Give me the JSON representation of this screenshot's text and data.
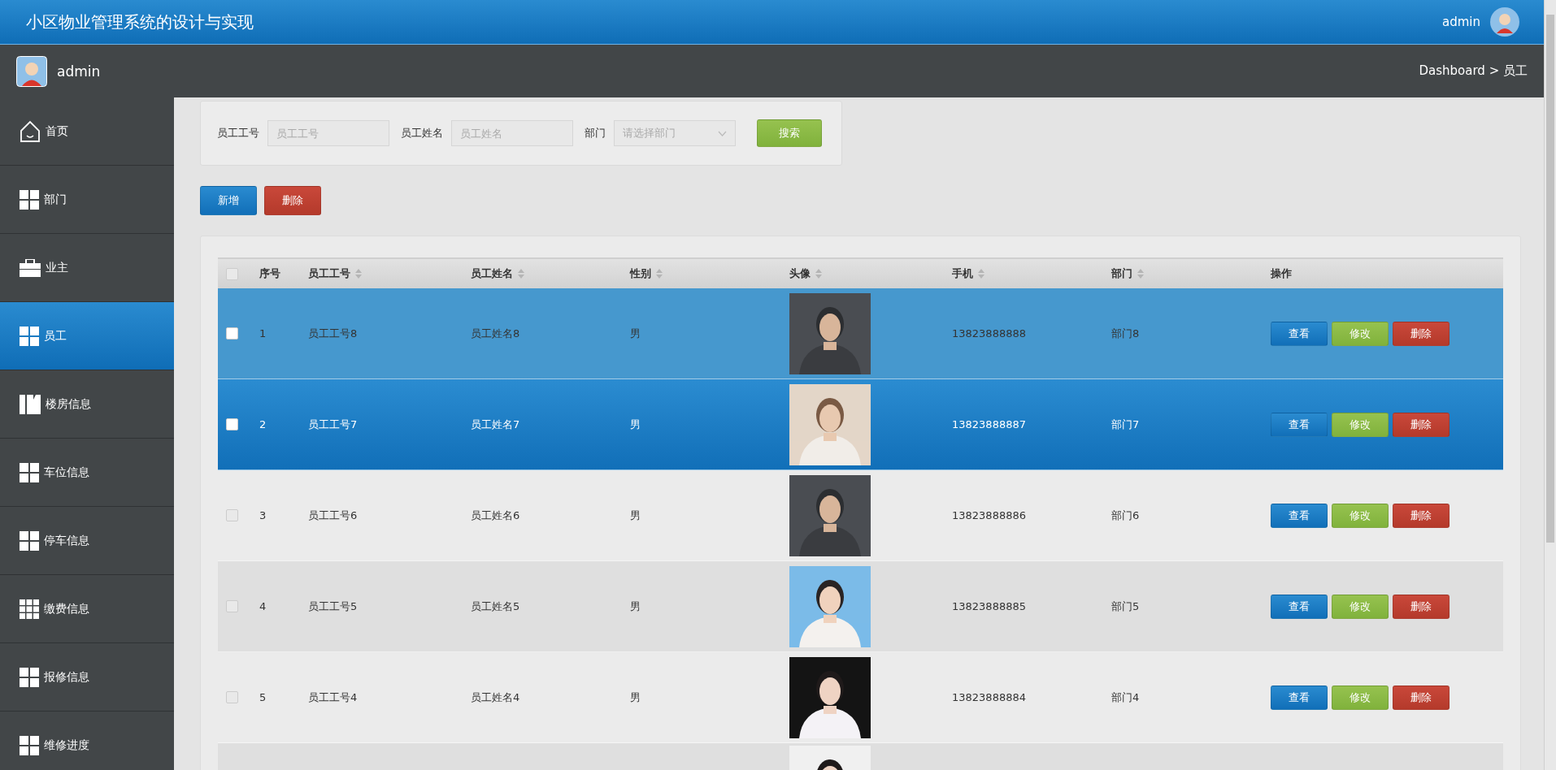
{
  "header": {
    "title": "小区物业管理系统的设计与实现",
    "user": "admin"
  },
  "subheader": {
    "user": "admin",
    "breadcrumb": "Dashboard > 员工"
  },
  "sidebar": {
    "items": [
      {
        "label": "首页",
        "kind": "home",
        "selected": false
      },
      {
        "label": "部门",
        "kind": "grid",
        "selected": false
      },
      {
        "label": "业主",
        "kind": "case",
        "selected": false
      },
      {
        "label": "员工",
        "kind": "grid",
        "selected": true
      },
      {
        "label": "楼房信息",
        "kind": "building",
        "selected": false
      },
      {
        "label": "车位信息",
        "kind": "grid",
        "selected": false
      },
      {
        "label": "停车信息",
        "kind": "grid",
        "selected": false
      },
      {
        "label": "缴费信息",
        "kind": "grid9",
        "selected": false
      },
      {
        "label": "报修信息",
        "kind": "grid",
        "selected": false
      },
      {
        "label": "维修进度",
        "kind": "grid",
        "selected": false
      }
    ]
  },
  "search": {
    "fields": [
      {
        "label": "员工工号",
        "placeholder": "员工工号",
        "kind": "text"
      },
      {
        "label": "员工姓名",
        "placeholder": "员工姓名",
        "kind": "text"
      },
      {
        "label": "部门",
        "placeholder": "请选择部门",
        "kind": "select"
      }
    ],
    "button": "搜索"
  },
  "actions": [
    {
      "label": "新增",
      "kind": "primary"
    },
    {
      "label": "删除",
      "kind": "danger"
    }
  ],
  "table": {
    "columns": [
      {
        "kind": "checkbox",
        "checked": false
      },
      {
        "label": "序号",
        "kind": "plain"
      },
      {
        "label": "员工工号",
        "kind": "sortable"
      },
      {
        "label": "员工姓名",
        "kind": "sortable"
      },
      {
        "label": "性别",
        "kind": "sortable"
      },
      {
        "label": "头像",
        "kind": "sortable"
      },
      {
        "label": "手机",
        "kind": "sortable"
      },
      {
        "label": "部门",
        "kind": "sortable"
      },
      {
        "label": "操作",
        "kind": "plain"
      }
    ],
    "rows": [
      {
        "kind": "full",
        "selected": true,
        "hovered": false,
        "index": "1",
        "emp_no": "员工工号8",
        "name": "员工姓名8",
        "gender": "男",
        "phone": "13823888888",
        "dept": "部门8",
        "buttons": [
          {
            "label": "查看",
            "kind": "view"
          },
          {
            "label": "修改",
            "kind": "edit"
          },
          {
            "label": "删除",
            "kind": "delete"
          }
        ]
      },
      {
        "kind": "full",
        "selected": true,
        "hovered": true,
        "index": "2",
        "emp_no": "员工工号7",
        "name": "员工姓名7",
        "gender": "男",
        "phone": "13823888887",
        "dept": "部门7",
        "buttons": [
          {
            "label": "查看",
            "kind": "view"
          },
          {
            "label": "修改",
            "kind": "edit"
          },
          {
            "label": "删除",
            "kind": "delete"
          }
        ]
      },
      {
        "kind": "full",
        "selected": false,
        "hovered": false,
        "index": "3",
        "emp_no": "员工工号6",
        "name": "员工姓名6",
        "gender": "男",
        "phone": "13823888886",
        "dept": "部门6",
        "buttons": [
          {
            "label": "查看",
            "kind": "view"
          },
          {
            "label": "修改",
            "kind": "edit"
          },
          {
            "label": "删除",
            "kind": "delete"
          }
        ]
      },
      {
        "kind": "full",
        "selected": false,
        "hovered": false,
        "index": "4",
        "emp_no": "员工工号5",
        "name": "员工姓名5",
        "gender": "男",
        "phone": "13823888885",
        "dept": "部门5",
        "buttons": [
          {
            "label": "查看",
            "kind": "view"
          },
          {
            "label": "修改",
            "kind": "edit"
          },
          {
            "label": "删除",
            "kind": "delete"
          }
        ]
      },
      {
        "kind": "full",
        "selected": false,
        "hovered": false,
        "index": "5",
        "emp_no": "员工工号4",
        "name": "员工姓名4",
        "gender": "男",
        "phone": "13823888884",
        "dept": "部门4",
        "buttons": [
          {
            "label": "查看",
            "kind": "view"
          },
          {
            "label": "修改",
            "kind": "edit"
          },
          {
            "label": "删除",
            "kind": "delete"
          }
        ]
      },
      {
        "kind": "partial"
      }
    ]
  }
}
